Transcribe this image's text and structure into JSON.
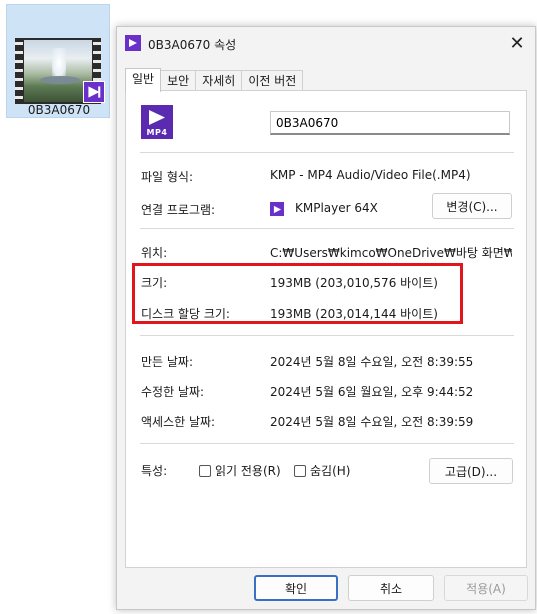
{
  "desktop_file": {
    "label": "0B3A0670"
  },
  "dialog": {
    "title": "0B3A0670 속성",
    "close": "✕",
    "tabs": [
      "일반",
      "보안",
      "자세히",
      "이전 버전"
    ],
    "file_name": "0B3A0670",
    "file_icon_text": "MP4",
    "fields": {
      "type_label": "파일 형식:",
      "type_value": "KMP - MP4 Audio/Video File(.MP4)",
      "opens_label": "연결 프로그램:",
      "opens_value": "KMPlayer 64X",
      "change_button": "변경(C)...",
      "location_label": "위치:",
      "location_value": "C:₩Users₩kimco₩OneDrive₩바탕 화면₩태화",
      "size_label": "크기:",
      "size_value": "193MB (203,010,576 바이트)",
      "disk_size_label": "디스크 할당 크기:",
      "disk_size_value": "193MB (203,014,144 바이트)",
      "created_label": "만든 날짜:",
      "created_value": "2024년 5월 8일 수요일, 오전 8:39:55",
      "modified_label": "수정한 날짜:",
      "modified_value": "2024년 5월 6일 월요일, 오후 9:44:52",
      "accessed_label": "액세스한 날짜:",
      "accessed_value": "2024년 5월 8일 수요일, 오전 8:39:59",
      "attributes_label": "특성:",
      "readonly_label": "읽기 전용(R)",
      "hidden_label": "숨김(H)",
      "advanced_button": "고급(D)..."
    },
    "buttons": {
      "ok": "확인",
      "cancel": "취소",
      "apply": "적용(A)"
    }
  },
  "colors": {
    "kmplayer_purple": "#6a31c9",
    "highlight_red": "#e0161c",
    "primary_border": "#3a6fc6"
  }
}
